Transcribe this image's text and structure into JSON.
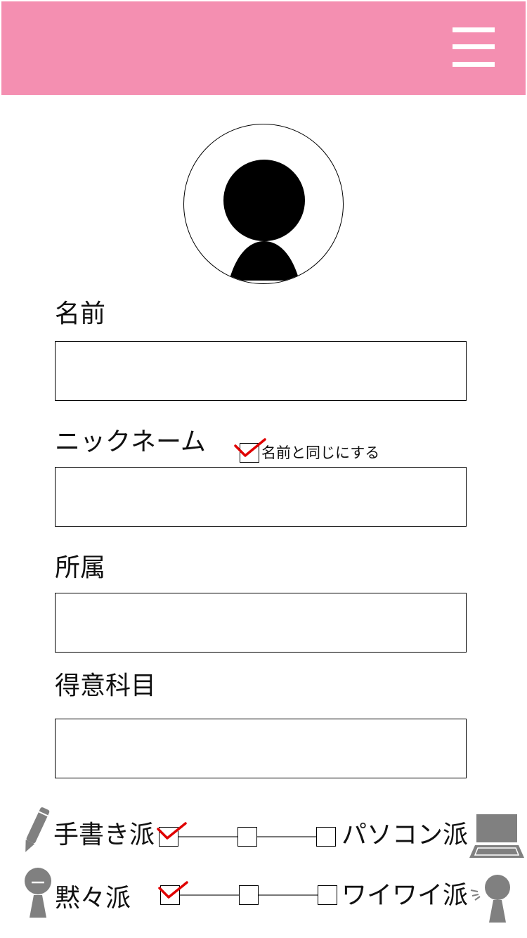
{
  "header": {
    "menu_icon": "hamburger-menu-icon",
    "bg_color": "#f48fb1"
  },
  "avatar": {
    "icon": "user-silhouette-icon"
  },
  "form": {
    "name_label": "名前",
    "name_value": "",
    "nickname_label": "ニックネーム",
    "nickname_value": "",
    "same_as_name_label": "名前と同じにする",
    "same_as_name_checked": true,
    "affiliation_label": "所属",
    "affiliation_value": "",
    "subject_label": "得意科目",
    "subject_value": ""
  },
  "preferences": [
    {
      "left_label": "手書き派",
      "right_label": "パソコン派",
      "left_icon": "pencil-icon",
      "right_icon": "laptop-icon",
      "selected_index": 0
    },
    {
      "left_label": "黙々派",
      "right_label": "ワイワイ派",
      "left_icon": "quiet-person-icon",
      "right_icon": "talking-person-icon",
      "selected_index": 0
    }
  ],
  "colors": {
    "check": "#e00000",
    "icon_gray": "#808080"
  }
}
